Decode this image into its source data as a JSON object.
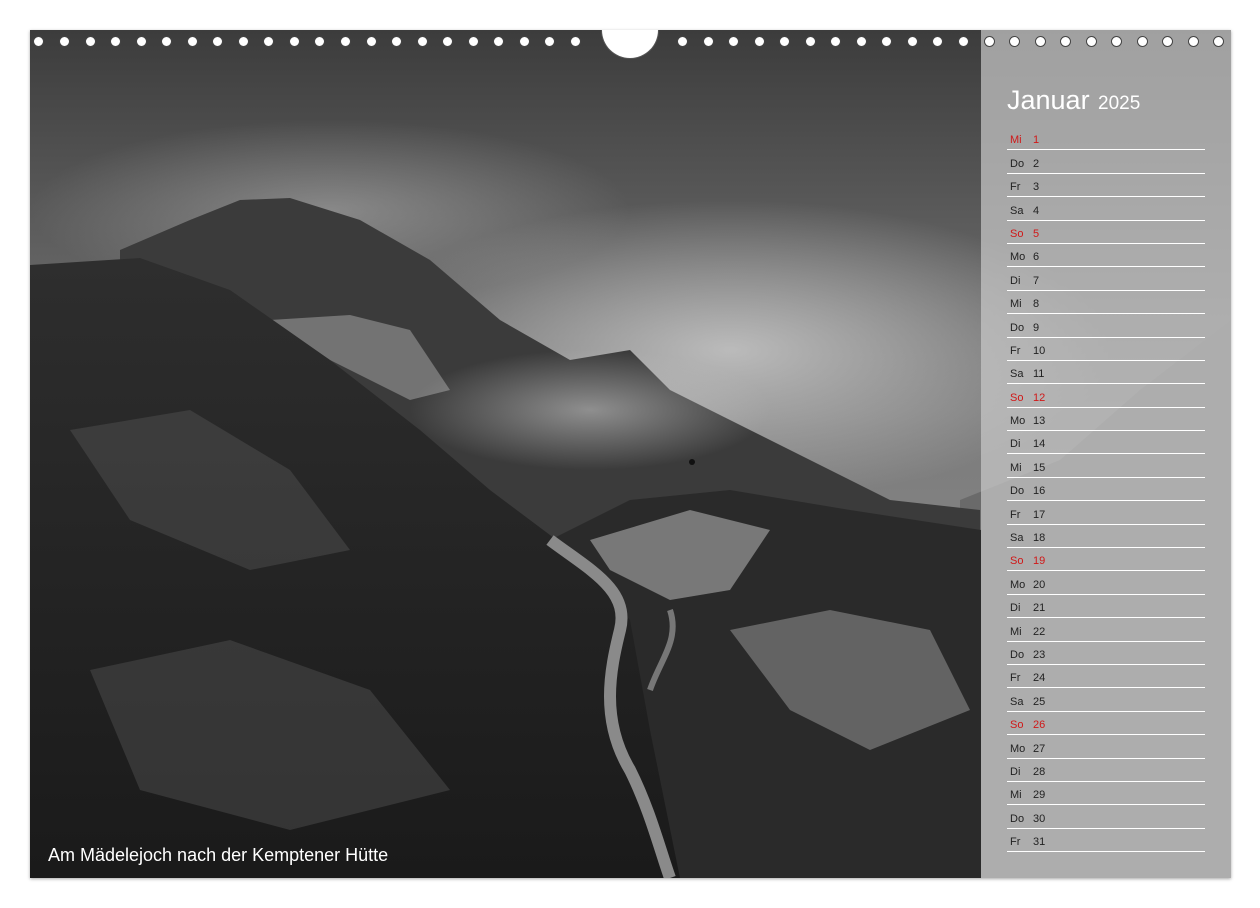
{
  "calendar": {
    "month": "Januar",
    "year": "2025",
    "days": [
      {
        "weekday": "Mi",
        "day": "1",
        "holiday": true
      },
      {
        "weekday": "Do",
        "day": "2",
        "holiday": false
      },
      {
        "weekday": "Fr",
        "day": "3",
        "holiday": false
      },
      {
        "weekday": "Sa",
        "day": "4",
        "holiday": false
      },
      {
        "weekday": "So",
        "day": "5",
        "holiday": true
      },
      {
        "weekday": "Mo",
        "day": "6",
        "holiday": false
      },
      {
        "weekday": "Di",
        "day": "7",
        "holiday": false
      },
      {
        "weekday": "Mi",
        "day": "8",
        "holiday": false
      },
      {
        "weekday": "Do",
        "day": "9",
        "holiday": false
      },
      {
        "weekday": "Fr",
        "day": "10",
        "holiday": false
      },
      {
        "weekday": "Sa",
        "day": "11",
        "holiday": false
      },
      {
        "weekday": "So",
        "day": "12",
        "holiday": true
      },
      {
        "weekday": "Mo",
        "day": "13",
        "holiday": false
      },
      {
        "weekday": "Di",
        "day": "14",
        "holiday": false
      },
      {
        "weekday": "Mi",
        "day": "15",
        "holiday": false
      },
      {
        "weekday": "Do",
        "day": "16",
        "holiday": false
      },
      {
        "weekday": "Fr",
        "day": "17",
        "holiday": false
      },
      {
        "weekday": "Sa",
        "day": "18",
        "holiday": false
      },
      {
        "weekday": "So",
        "day": "19",
        "holiday": true
      },
      {
        "weekday": "Mo",
        "day": "20",
        "holiday": false
      },
      {
        "weekday": "Di",
        "day": "21",
        "holiday": false
      },
      {
        "weekday": "Mi",
        "day": "22",
        "holiday": false
      },
      {
        "weekday": "Do",
        "day": "23",
        "holiday": false
      },
      {
        "weekday": "Fr",
        "day": "24",
        "holiday": false
      },
      {
        "weekday": "Sa",
        "day": "25",
        "holiday": false
      },
      {
        "weekday": "So",
        "day": "26",
        "holiday": true
      },
      {
        "weekday": "Mo",
        "day": "27",
        "holiday": false
      },
      {
        "weekday": "Di",
        "day": "28",
        "holiday": false
      },
      {
        "weekday": "Mi",
        "day": "29",
        "holiday": false
      },
      {
        "weekday": "Do",
        "day": "30",
        "holiday": false
      },
      {
        "weekday": "Fr",
        "day": "31",
        "holiday": false
      }
    ]
  },
  "photo": {
    "caption": "Am Mädelejoch nach der Kemptener Hütte"
  },
  "colors": {
    "holiday": "#d01818",
    "text": "#222222",
    "panel": "#c8c8c8"
  }
}
